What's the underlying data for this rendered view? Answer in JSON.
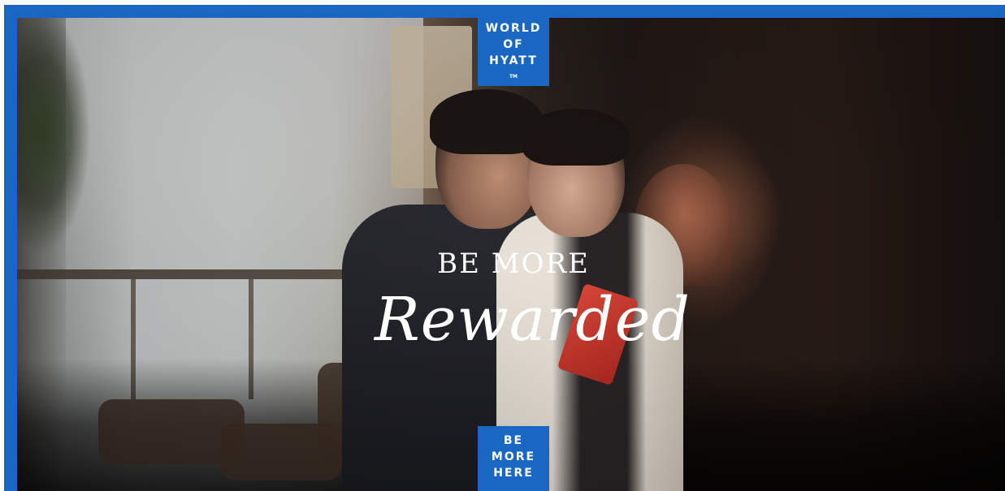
{
  "brand": {
    "logo_line1": "WORLD",
    "logo_line2": "OF",
    "logo_line3": "HYATT",
    "logo_tm": "TM",
    "color": "#1967c3"
  },
  "hero": {
    "headline": "BE MORE",
    "script": "Rewarded",
    "image_subject": "two-people-looking-at-tablet"
  },
  "cta": {
    "line1": "BE",
    "line2": "MORE",
    "line3": "HERE"
  }
}
